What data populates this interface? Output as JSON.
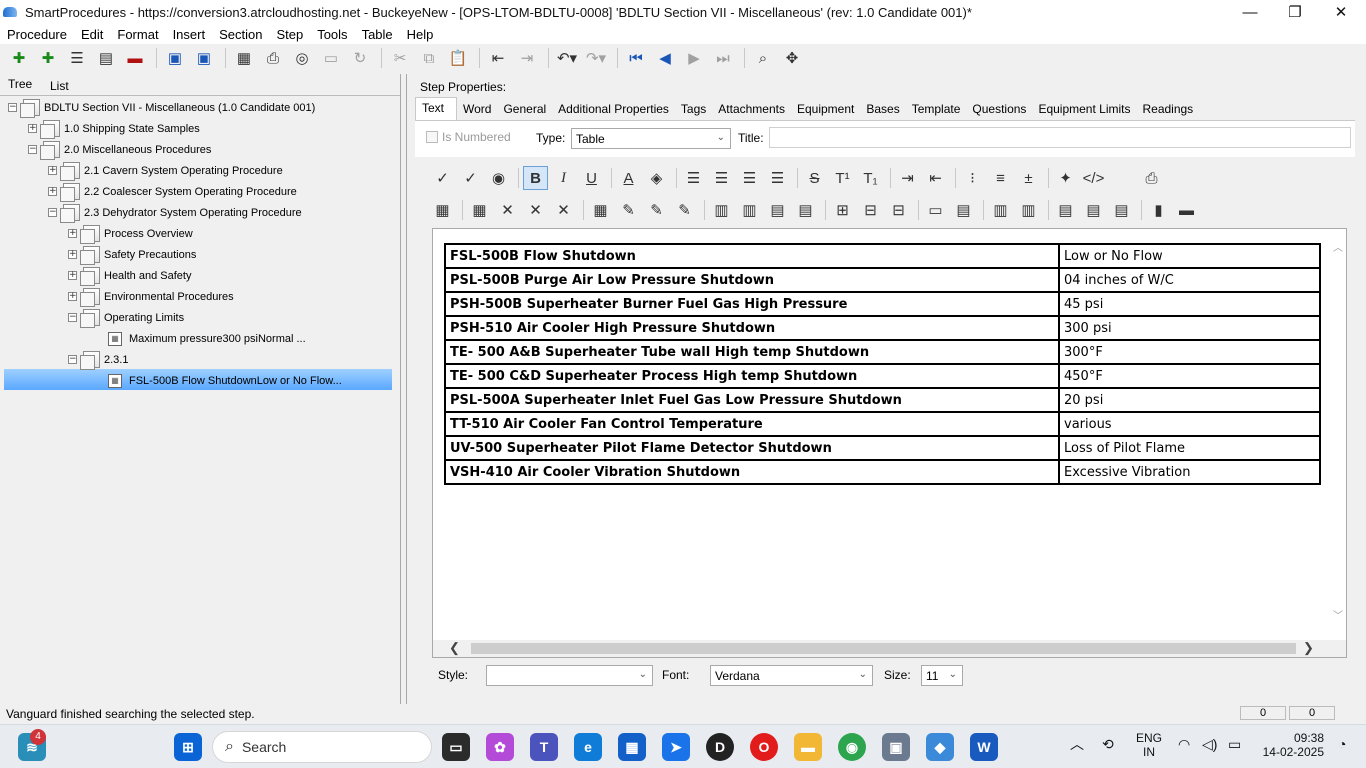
{
  "window": {
    "title": "SmartProcedures - https://conversion3.atrcloudhosting.net - BuckeyeNew - [OPS-LTOM-BDLTU-0008] 'BDLTU Section VII - Miscellaneous' (rev: 1.0 Candidate 001)*",
    "minimize": "—",
    "maximize": "❐",
    "close": "✕"
  },
  "menu": [
    "Procedure",
    "Edit",
    "Format",
    "Insert",
    "Section",
    "Step",
    "Tools",
    "Table",
    "Help"
  ],
  "left_tabs": {
    "tree": "Tree",
    "list": "List"
  },
  "tree": {
    "root": "BDLTU Section VII - Miscellaneous (1.0 Candidate 001)",
    "n1": "1.0 Shipping State Samples",
    "n2": "2.0 Miscellaneous Procedures",
    "n21": "2.1 Cavern System Operating Procedure",
    "n22": "2.2 Coalescer System Operating Procedure",
    "n23": "2.3 Dehydrator System Operating Procedure",
    "process": "Process Overview",
    "safety": "Safety Precautions",
    "health": "Health and Safety",
    "env": "Environmental Procedures",
    "oplimits": "Operating Limits",
    "maxp": "Maximum pressure300 psiNormal ...",
    "n231": "2.3.1",
    "fsl": "FSL-500B Flow ShutdownLow or No Flow..."
  },
  "step": {
    "header": "Step Properties:",
    "tabs": [
      "Text",
      "Word",
      "General",
      "Additional Properties",
      "Tags",
      "Attachments",
      "Equipment",
      "Bases",
      "Template",
      "Questions",
      "Equipment Limits",
      "Readings"
    ],
    "is_numbered": "Is Numbered",
    "type_label": "Type:",
    "type_value": "Table",
    "title_label": "Title:",
    "title_value": ""
  },
  "table_rows": [
    {
      "name": "FSL-500B Flow Shutdown",
      "value": "Low or No Flow"
    },
    {
      "name": "PSL-500B Purge Air Low Pressure Shutdown",
      "value": "04 inches of W/C"
    },
    {
      "name": "PSH-500B Superheater Burner Fuel Gas High Pressure",
      "value": "45 psi"
    },
    {
      "name": "PSH-510 Air Cooler High Pressure Shutdown",
      "value": "300 psi"
    },
    {
      "name": "TE- 500 A&B Superheater Tube wall High temp Shutdown",
      "value": "300°F"
    },
    {
      "name": "TE- 500 C&D Superheater Process High temp Shutdown",
      "value": "450°F"
    },
    {
      "name": "PSL-500A Superheater Inlet Fuel Gas Low Pressure Shutdown",
      "value": "20 psi"
    },
    {
      "name": "TT-510 Air Cooler Fan Control Temperature",
      "value": "various"
    },
    {
      "name": "UV-500 Superheater Pilot Flame Detector Shutdown",
      "value": "Loss of Pilot Flame"
    },
    {
      "name": "VSH-410 Air Cooler Vibration Shutdown",
      "value": "Excessive Vibration"
    }
  ],
  "bottom": {
    "style_label": "Style:",
    "style_value": "",
    "font_label": "Font:",
    "font_value": "Verdana",
    "size_label": "Size:",
    "size_value": "11"
  },
  "status_text": "Vanguard finished searching the selected step.",
  "status_fields": [
    "0",
    "0"
  ],
  "taskbar": {
    "search": "Search",
    "notif_badge": "4",
    "lang_top": "ENG",
    "lang_bottom": "IN",
    "time": "09:38",
    "date": "14-02-2025"
  },
  "colors": {
    "selection": "#5aa8ff",
    "accent": "#1a55b8"
  }
}
